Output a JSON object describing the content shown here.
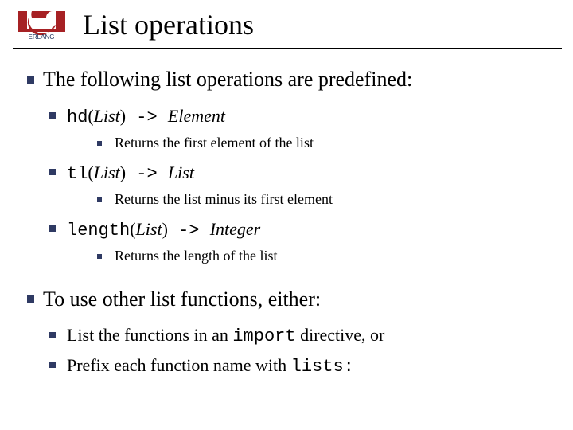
{
  "logo": {
    "name": "ERLANG"
  },
  "title": "List operations",
  "section1": {
    "heading": "The following list operations are predefined:",
    "items": [
      {
        "fn": "hd",
        "open": "(",
        "arg": "List",
        "close": ")",
        "arrow": " -> ",
        "ret": "Element",
        "desc": "Returns the first element of the list"
      },
      {
        "fn": "tl",
        "open": "(",
        "arg": "List",
        "close": ")",
        "arrow": " -> ",
        "ret": "List",
        "desc": "Returns the list minus its first element"
      },
      {
        "fn": "length",
        "open": "(",
        "arg": "List",
        "close": ")",
        "arrow": " -> ",
        "ret": "Integer",
        "desc": "Returns the length of the list"
      }
    ]
  },
  "section2": {
    "heading": "To use other list functions, either:",
    "items": [
      {
        "pre": "List the functions in an ",
        "code": "import",
        "post": " directive, or"
      },
      {
        "pre": "Prefix each function name with ",
        "code": "lists:",
        "post": ""
      }
    ]
  }
}
